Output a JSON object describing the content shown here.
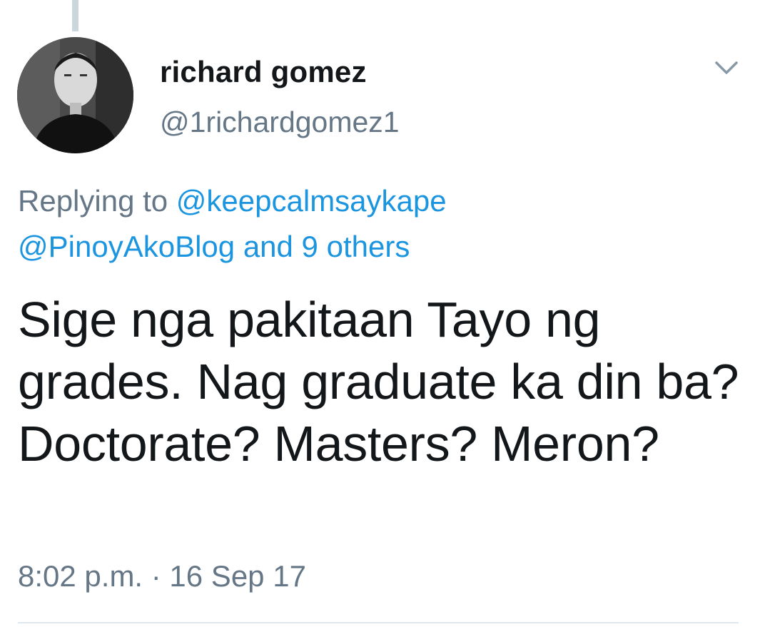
{
  "tweet": {
    "author": {
      "display_name": "richard gomez",
      "handle": "@1richardgomez1"
    },
    "reply": {
      "prefix": "Replying to",
      "mention_1": "@keepcalmsaykape",
      "mention_2": "@PinoyAkoBlog",
      "and_others": "and 9 others"
    },
    "text": "Sige nga pakitaan Tayo ng grades. Nag graduate ka din ba? Doctorate? Masters? Meron?",
    "timestamp": "8:02 p.m. · 16 Sep 17"
  },
  "icons": {
    "menu": "chevron-down-icon"
  },
  "colors": {
    "text_primary": "#14171a",
    "text_secondary": "#657786",
    "link": "#1b95e0",
    "thread_line": "#ccd6dd",
    "divider": "#e1e8ed"
  }
}
